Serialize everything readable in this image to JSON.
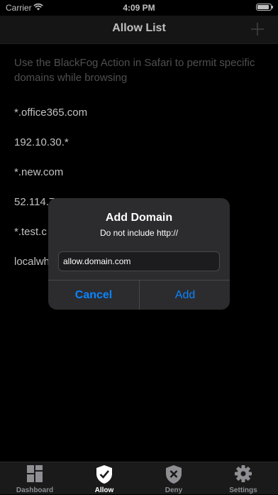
{
  "status_bar": {
    "carrier": "Carrier",
    "time": "4:09 PM",
    "battery_level": 0.9
  },
  "nav": {
    "title": "Allow List"
  },
  "description": "Use the BlackFog Action in Safari to permit specific domains while browsing",
  "domains": [
    "*.office365.com",
    "192.10.30.*",
    "*.new.com",
    "52.114.7",
    "*.test.c",
    "localwh"
  ],
  "dialog": {
    "title": "Add Domain",
    "message": "Do not include http://",
    "input_value": "allow.domain.com",
    "cancel_label": "Cancel",
    "add_label": "Add"
  },
  "tabs": [
    {
      "label": "Dashboard",
      "icon": "dashboard-icon",
      "active": false
    },
    {
      "label": "Allow",
      "icon": "shield-check-icon",
      "active": true
    },
    {
      "label": "Deny",
      "icon": "shield-x-icon",
      "active": false
    },
    {
      "label": "Settings",
      "icon": "gear-icon",
      "active": false
    }
  ],
  "colors": {
    "accent": "#0a84ff",
    "background": "#000000",
    "dialog": "#2c2c2e",
    "tab_inactive": "#8e8e93"
  }
}
